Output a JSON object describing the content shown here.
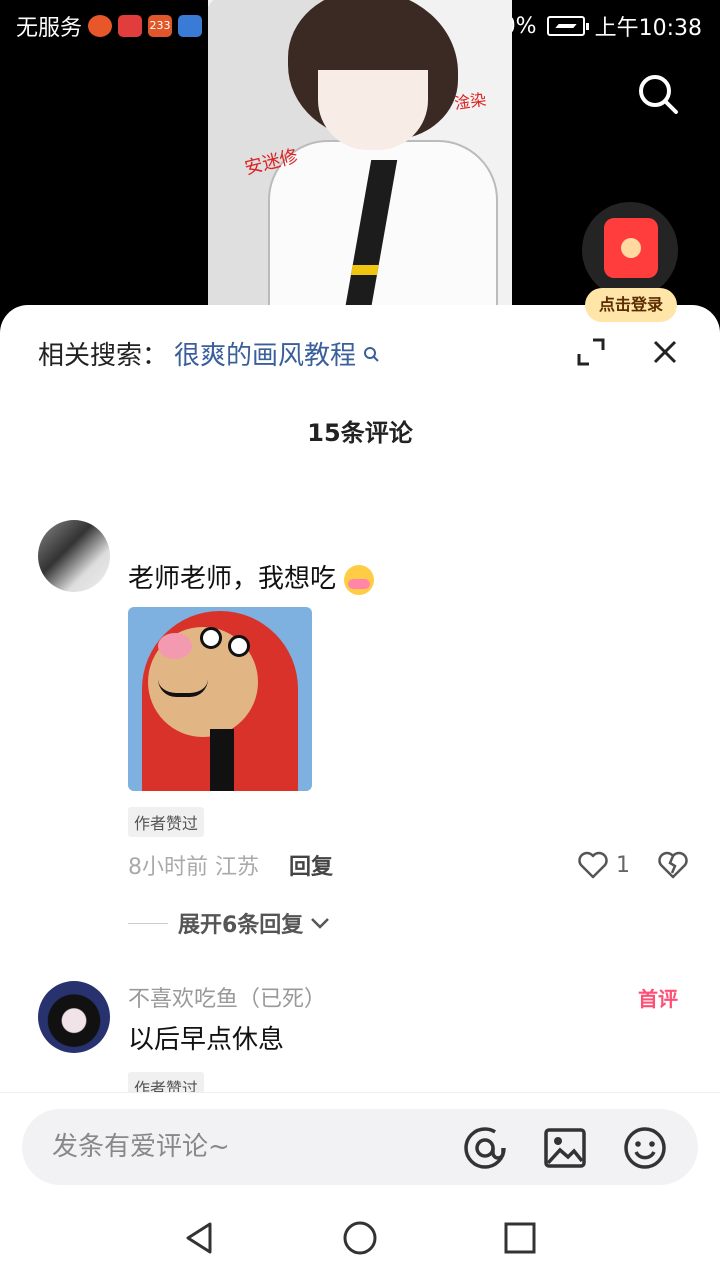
{
  "status_bar": {
    "carrier": "无服务",
    "app_badge": "233",
    "battery_percent": "0%",
    "time": "上午10:38"
  },
  "video": {
    "signature_left": "安迷修",
    "signature_right": "淦染"
  },
  "floating": {
    "login_label": "点击登录"
  },
  "panel": {
    "related_prefix": "相关搜索：",
    "related_keyword": "很爽的画风教程",
    "comment_count_title": "15条评论"
  },
  "comments": [
    {
      "username": "",
      "text": "老师老师，我想吃",
      "author_liked_badge": "作者赞过",
      "time_location": "8小时前 江苏",
      "reply_label": "回复",
      "like_count": "1",
      "expand_replies_label": "展开6条回复"
    },
    {
      "username": "不喜欢吃鱼（已死）",
      "text": "以后早点休息",
      "author_liked_badge": "作者赞过",
      "first_badge": "首评"
    }
  ],
  "input_bar": {
    "placeholder": "发条有爱评论~"
  },
  "colors": {
    "accent_link": "#3a5f9a",
    "first_comment_badge": "#ff4f76",
    "login_pill_bg": "#ffe5a8"
  }
}
